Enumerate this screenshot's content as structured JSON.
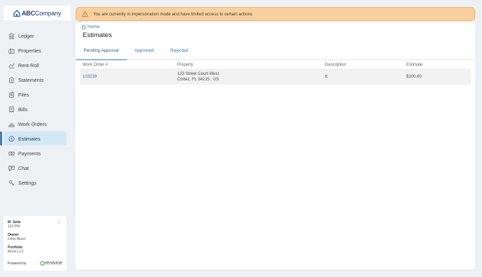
{
  "logo": {
    "prefix": "ABC",
    "suffix": " Company"
  },
  "sidebar": {
    "items": [
      {
        "label": "Ledger",
        "icon": "ledger-icon"
      },
      {
        "label": "Properties",
        "icon": "properties-icon"
      },
      {
        "label": "Rent Roll",
        "icon": "rent-roll-icon"
      },
      {
        "label": "Statements",
        "icon": "statements-icon"
      },
      {
        "label": "Files",
        "icon": "files-icon"
      },
      {
        "label": "Bills",
        "icon": "bills-icon"
      },
      {
        "label": "Work Orders",
        "icon": "work-orders-icon"
      },
      {
        "label": "Estimates",
        "icon": "estimates-icon",
        "active": true
      },
      {
        "label": "Payments",
        "icon": "payments-icon"
      },
      {
        "label": "Chat",
        "icon": "chat-icon"
      },
      {
        "label": "Settings",
        "icon": "settings-icon"
      }
    ]
  },
  "user_card": {
    "name": "M. Sefa",
    "time": "123 PM",
    "owner_label": "Owner",
    "owner_value": "Chris Moon",
    "portfolio_label": "Portfolio",
    "portfolio_value": "Moon LLC",
    "powered_by": "Powered by",
    "brand": "rentvine"
  },
  "banner": {
    "text": "You are currently in impersonation mode and have limited access to certain actions"
  },
  "breadcrumb": {
    "home": "Home"
  },
  "page": {
    "title": "Estimates"
  },
  "tabs": [
    {
      "label": "Pending Approval",
      "active": true
    },
    {
      "label": "Approved"
    },
    {
      "label": "Rejected"
    }
  ],
  "table": {
    "headers": [
      "Work Order #",
      "Property",
      "Description",
      "Estimate"
    ],
    "rows": [
      {
        "work_order": "103239",
        "property_line1": "123 Street Court West",
        "property_line2": "Cortez, FL 34215 , US",
        "description": "tt",
        "estimate": "$100.00"
      }
    ]
  },
  "colors": {
    "accent": "#3d7fbf",
    "banner_bg": "#f8d0a0",
    "active_nav": "#d3e8f5"
  }
}
